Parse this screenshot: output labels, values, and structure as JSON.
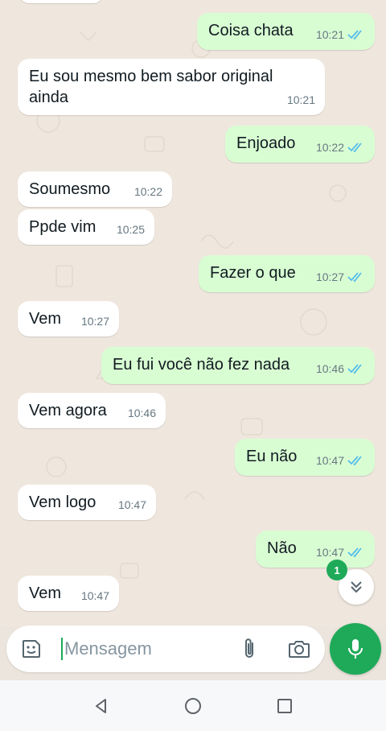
{
  "messages": [
    {
      "direction": "out",
      "text": "Coisa chata",
      "time": "10:21",
      "read": true
    },
    {
      "direction": "in",
      "text_lines": [
        "Eu sou mesmo bem sabor original",
        "ainda"
      ],
      "time": "10:21"
    },
    {
      "direction": "out",
      "text": "Enjoado",
      "time": "10:22",
      "read": true
    },
    {
      "direction": "in",
      "text": "Soumesmo",
      "time": "10:22"
    },
    {
      "direction": "in",
      "text": "Ppde vim",
      "time": "10:25"
    },
    {
      "direction": "out",
      "text": "Fazer o que",
      "time": "10:27",
      "read": true
    },
    {
      "direction": "in",
      "text": "Vem",
      "time": "10:27"
    },
    {
      "direction": "out",
      "text": "Eu fui você não fez nada",
      "time": "10:46",
      "read": true
    },
    {
      "direction": "in",
      "text": "Vem agora",
      "time": "10:46"
    },
    {
      "direction": "out",
      "text": "Eu não",
      "time": "10:47",
      "read": true
    },
    {
      "direction": "in",
      "text": "Vem logo",
      "time": "10:47"
    },
    {
      "direction": "out",
      "text": "Não",
      "time": "10:47",
      "read": true
    },
    {
      "direction": "in",
      "text": "Vem",
      "time": "10:47"
    }
  ],
  "unread_count": "1",
  "composer": {
    "placeholder": "Mensagem",
    "value": ""
  },
  "icons": {
    "emoji": "sticker-smiley-icon",
    "attach": "paperclip-icon",
    "camera": "camera-icon",
    "mic": "microphone-icon",
    "scroll_down": "double-chevron-down-icon",
    "read_receipt": "double-check-icon",
    "nav_back": "triangle-back-icon",
    "nav_home": "circle-home-icon",
    "nav_recents": "square-recents-icon"
  },
  "colors": {
    "outgoing_bubble": "#d9fdd3",
    "incoming_bubble": "#ffffff",
    "accent_green": "#1faa59",
    "read_tick_blue": "#53bdeb",
    "chat_background": "#efe7de"
  }
}
